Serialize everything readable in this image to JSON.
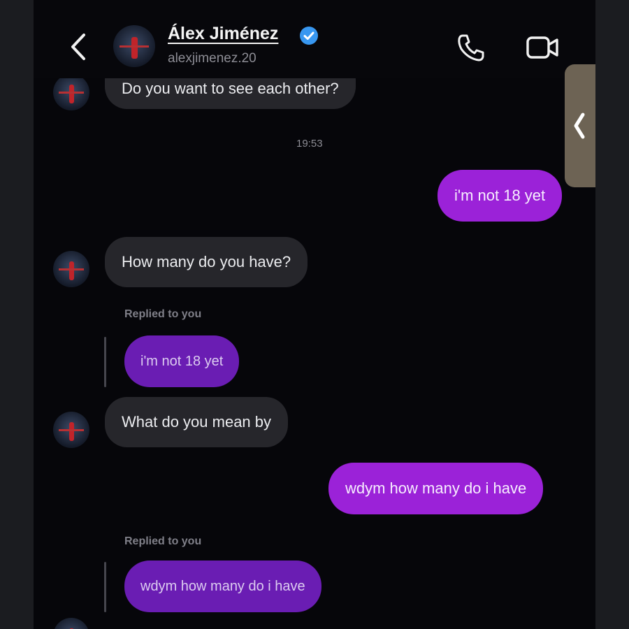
{
  "header": {
    "contact_name": "Álex Jiménez",
    "handle": "alexjimenez.20"
  },
  "messages": [
    {
      "direction": "incoming",
      "text": "Do you want to see each other?"
    },
    {
      "timestamp": "19:53"
    },
    {
      "direction": "outgoing",
      "text": "i'm not 18 yet"
    },
    {
      "direction": "incoming",
      "text": "How many do you have?",
      "reply_label": "Replied to you",
      "quoted": "i'm not 18 yet"
    },
    {
      "direction": "incoming",
      "text": "What do you mean by"
    },
    {
      "direction": "outgoing",
      "text": "wdym how many do i have"
    },
    {
      "direction": "incoming",
      "reply_label": "Replied to you",
      "quoted": "wdym how many do i have"
    }
  ],
  "icons": {
    "back": "chevron-left-icon",
    "verified": "verified-badge-icon",
    "call": "phone-icon",
    "video": "video-camera-icon",
    "side_handle": "chevron-left-icon"
  },
  "colors": {
    "background": "#06060a",
    "incoming_bubble": "#26262b",
    "outgoing_bubble": "#9b22d8",
    "reply_bubble": "#6a1db3",
    "verified": "#3897f0"
  }
}
